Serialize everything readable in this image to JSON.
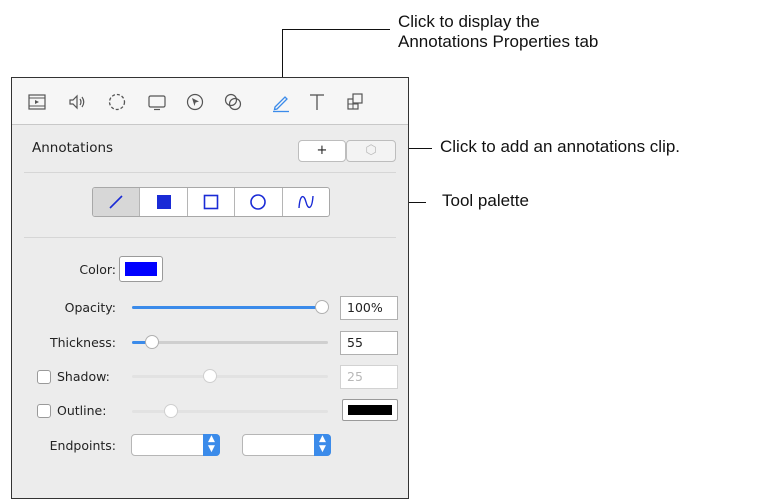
{
  "callouts": {
    "tab_line1": "Click to display the",
    "tab_line2": "Annotations Properties tab",
    "add_clip": "Click to add an annotations clip.",
    "tool_palette": "Tool palette"
  },
  "toolbar": {
    "icons": [
      "film-icon",
      "speaker-icon",
      "dashed-circle-icon",
      "monitor-icon",
      "cursor-icon",
      "overlap-circles-icon",
      "pencil-icon",
      "text-icon",
      "puzzle-icon"
    ],
    "active_icon": "pencil-icon",
    "accent": "#3b8bea"
  },
  "section": {
    "title": "Annotations",
    "add_label": "+",
    "extra_label": "⬡"
  },
  "palette": {
    "tools": [
      "line-tool",
      "filled-rect-tool",
      "rect-tool",
      "ellipse-tool",
      "curve-tool"
    ],
    "selected": "line-tool",
    "icon_color": "#1a2bd6"
  },
  "properties": {
    "color_label": "Color:",
    "color_value": "#0000ff",
    "opacity_label": "Opacity:",
    "opacity_value": "100%",
    "opacity_level": 1.0,
    "thickness_label": "Thickness:",
    "thickness_value": "55",
    "thickness_level": 0.1,
    "shadow_label": "Shadow:",
    "shadow_value": "25",
    "shadow_level": 0.4,
    "outline_label": "Outline:",
    "outline_color": "#000000",
    "outline_level": 0.2,
    "endpoints_label": "Endpoints:"
  }
}
